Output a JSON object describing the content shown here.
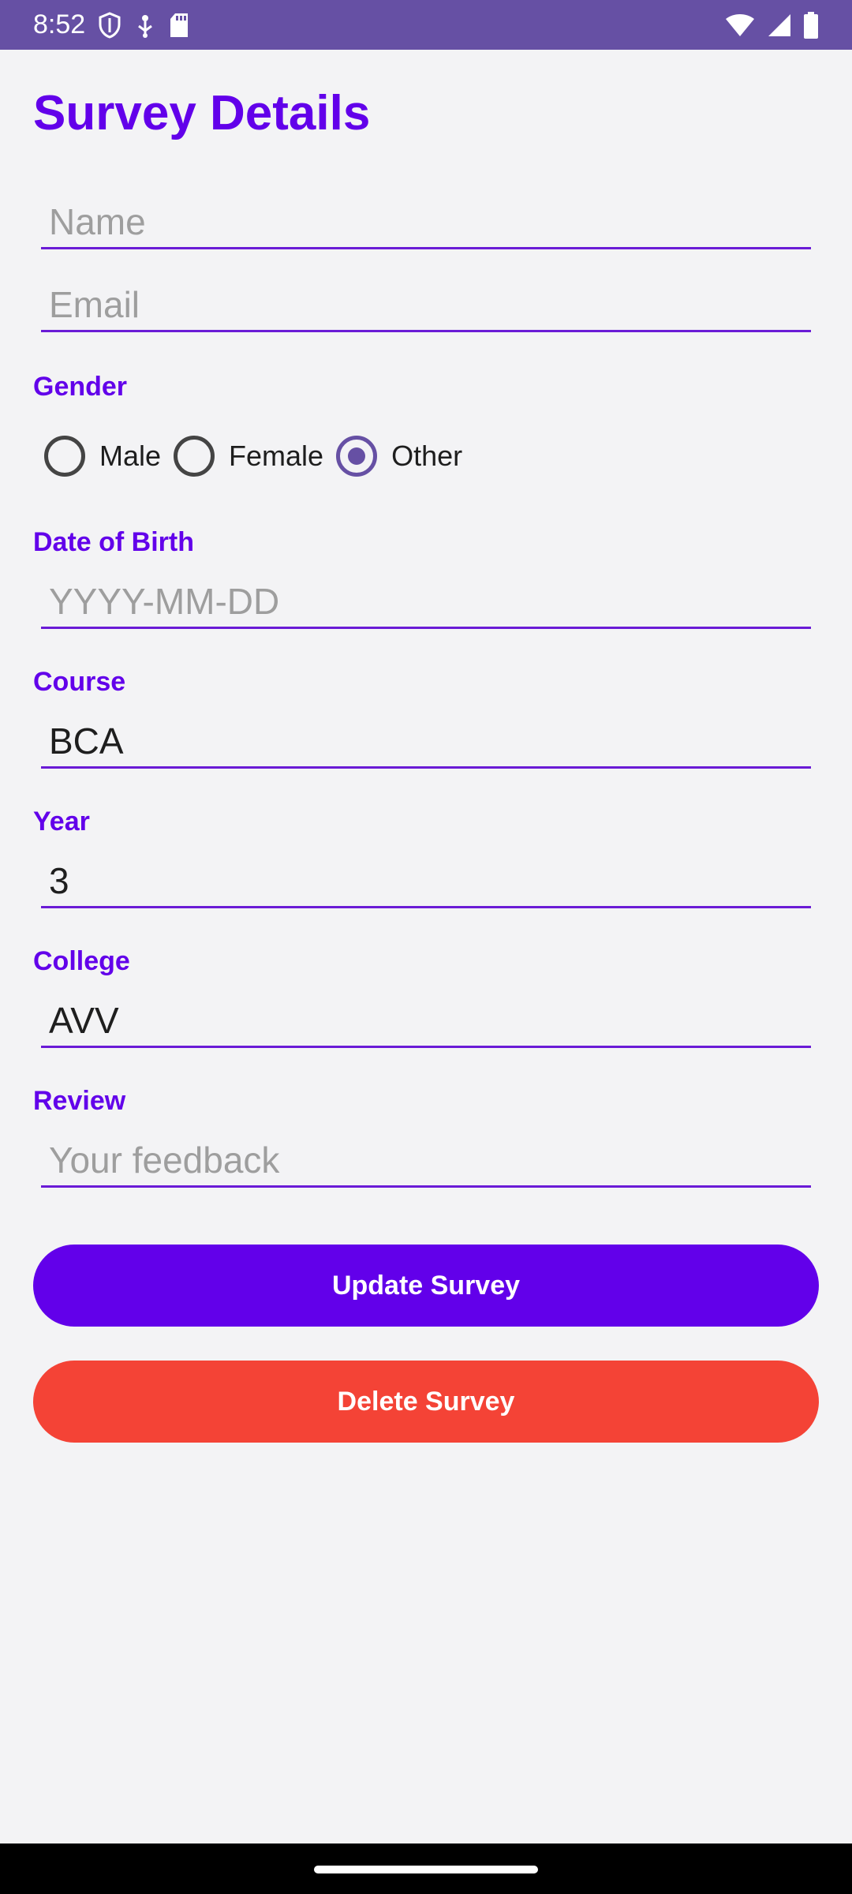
{
  "status_bar": {
    "time": "8:52",
    "left_icons": [
      "shield-icon",
      "usb-icon",
      "sd-card-icon"
    ],
    "right_icons": [
      "wifi-icon",
      "signal-icon",
      "battery-icon"
    ]
  },
  "page": {
    "title": "Survey Details"
  },
  "fields": {
    "name": {
      "placeholder": "Name",
      "value": ""
    },
    "email": {
      "placeholder": "Email",
      "value": ""
    },
    "dob": {
      "label": "Date of Birth",
      "placeholder": "YYYY-MM-DD",
      "value": ""
    },
    "course": {
      "label": "Course",
      "value": "BCA"
    },
    "year": {
      "label": "Year",
      "value": "3"
    },
    "college": {
      "label": "College",
      "value": "AVV"
    },
    "review": {
      "label": "Review",
      "placeholder": "Your feedback",
      "value": ""
    }
  },
  "gender": {
    "label": "Gender",
    "options": [
      {
        "label": "Male",
        "checked": false
      },
      {
        "label": "Female",
        "checked": false
      },
      {
        "label": "Other",
        "checked": true
      }
    ]
  },
  "buttons": {
    "update": "Update Survey",
    "delete": "Delete Survey"
  },
  "colors": {
    "accent": "#6200ea",
    "status_bar": "#6650a4",
    "delete": "#f44336",
    "background": "#f3f3f5"
  }
}
